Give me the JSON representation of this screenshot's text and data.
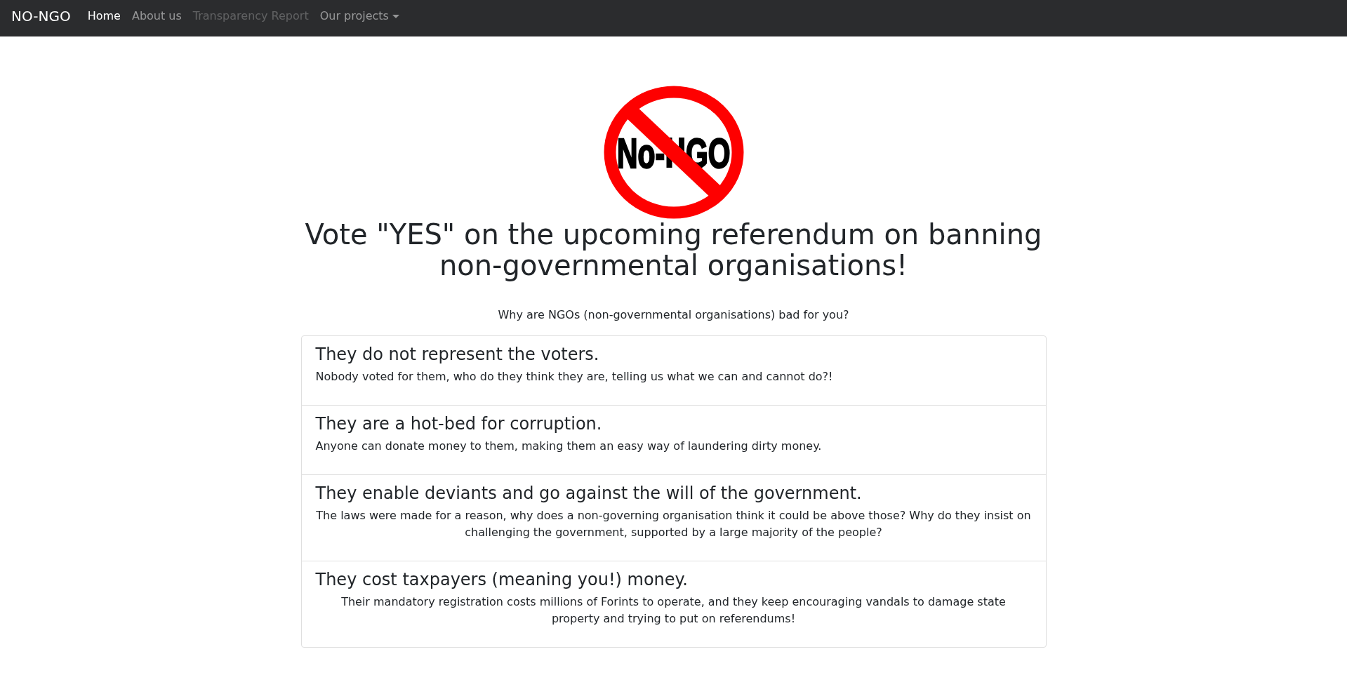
{
  "navbar": {
    "brand": "NO-NGO",
    "items": [
      {
        "label": "Home",
        "kind": "link",
        "selected": true,
        "disabled": false
      },
      {
        "label": "About us",
        "kind": "link",
        "selected": false,
        "disabled": false
      },
      {
        "label": "Transparency Report",
        "kind": "link",
        "selected": false,
        "disabled": true
      },
      {
        "label": "Our projects",
        "kind": "dropdown",
        "selected": false,
        "disabled": false
      }
    ]
  },
  "hero": {
    "logo": {
      "texts": [
        "No-",
        "GO"
      ]
    },
    "heading": "Vote \"YES\" on the upcoming referendum on banning non-governmental organisations!",
    "subheading": "Why are NGOs (non-governmental organisations) bad for you?"
  },
  "reasons": [
    {
      "kind": "plain",
      "title": "They do not represent the voters.",
      "text": "Nobody voted for them, who do they think they are, telling us what we can and cannot do?!"
    },
    {
      "kind": "plain",
      "title": "They are a hot-bed for corruption.",
      "text": "Anyone can donate money to them, making them an easy way of laundering dirty money."
    },
    {
      "kind": "centered",
      "title": "They enable deviants and go against the will of the government.",
      "text": "The laws were made for a reason, why does a non-governing organisation think it could be above those? Why do they insist on challenging the government, supported by a large majority of the people?"
    },
    {
      "kind": "centered",
      "title": "They cost taxpayers (meaning you!) money.",
      "text": "Their mandatory registration costs millions of Forints to operate, and they keep encouraging vandals to damage state property and trying to put on referendums!"
    }
  ]
}
